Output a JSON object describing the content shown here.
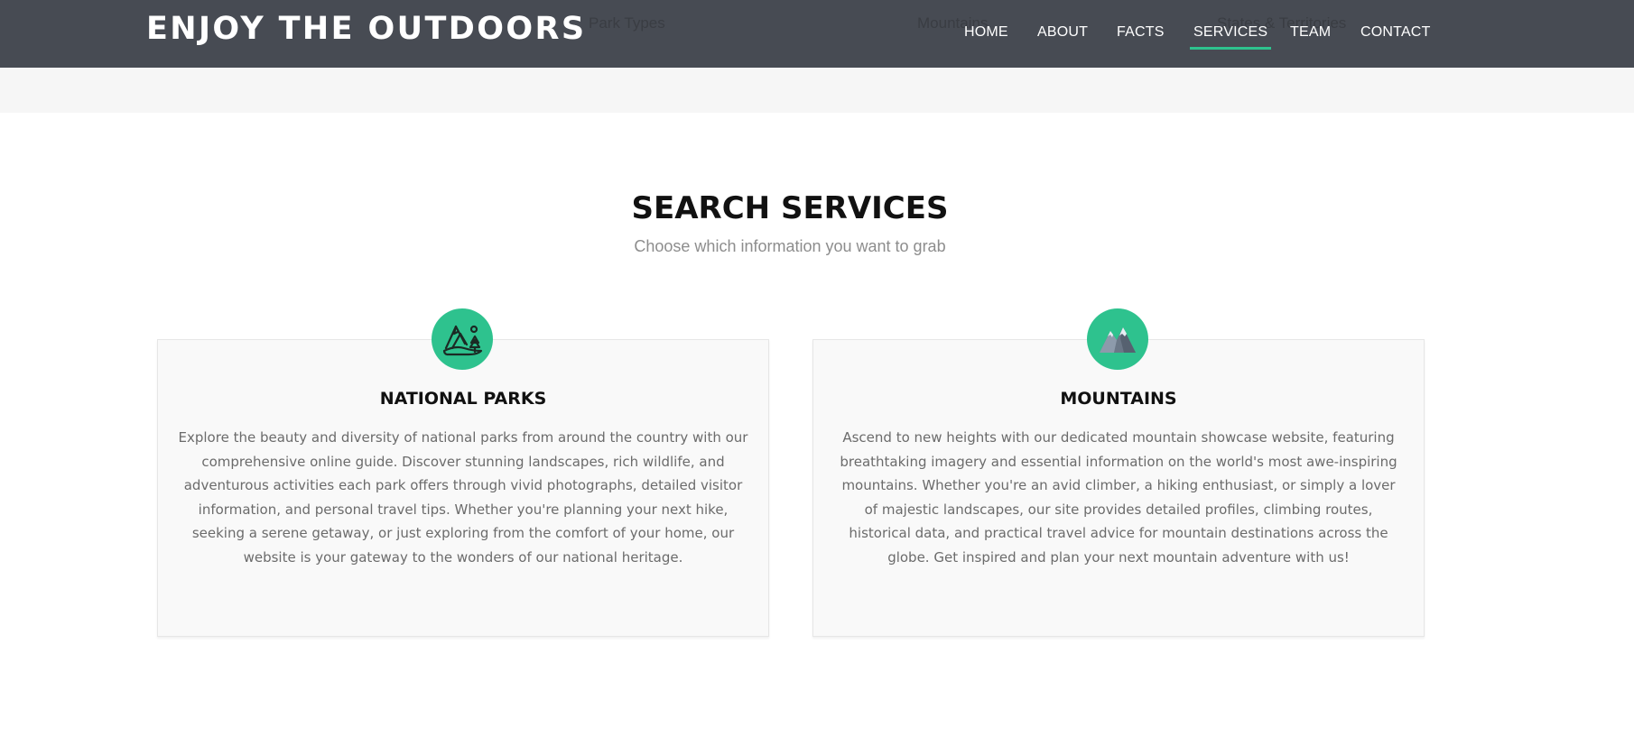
{
  "header": {
    "logo": "ENJOY THE OUTDOORS",
    "underlying_links": [
      "Park Types",
      "Mountains",
      "States & Territories"
    ],
    "nav": [
      "HOME",
      "ABOUT",
      "FACTS",
      "SERVICES",
      "TEAM",
      "CONTACT"
    ],
    "active_nav": "SERVICES",
    "background_color": "#474b53",
    "accent_color": "#2ec28e"
  },
  "services": {
    "title": "SEARCH SERVICES",
    "subtitle": "Choose which information you want to grab",
    "cards": [
      {
        "icon": "national-park-icon",
        "title": "NATIONAL PARKS",
        "text": "Explore the beauty and diversity of national parks from around the country with our comprehensive online guide. Discover stunning landscapes, rich wildlife, and adventurous activities each park offers through vivid photographs, detailed visitor information, and personal travel tips. Whether you're planning your next hike, seeking a serene getaway, or just exploring from the comfort of your home, our website is your gateway to the wonders of our national heritage."
      },
      {
        "icon": "mountain-icon",
        "title": "MOUNTAINS",
        "text": "Ascend to new heights with our dedicated mountain showcase website, featuring breathtaking imagery and essential information on the world's most awe-inspiring mountains. Whether you're an avid climber, a hiking enthusiast, or simply a lover of majestic landscapes, our site provides detailed profiles, climbing routes, historical data, and practical travel advice for mountain destinations across the globe. Get inspired and plan your next mountain adventure with us!"
      }
    ]
  }
}
